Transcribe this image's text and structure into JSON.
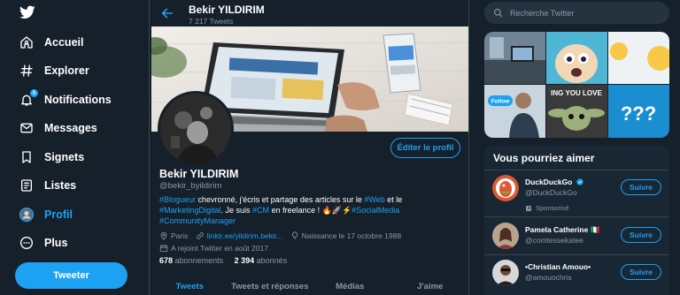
{
  "nav": {
    "items": [
      {
        "label": "Accueil",
        "icon": "home-icon"
      },
      {
        "label": "Explorer",
        "icon": "hashtag-icon"
      },
      {
        "label": "Notifications",
        "icon": "bell-icon",
        "badge": "5"
      },
      {
        "label": "Messages",
        "icon": "envelope-icon"
      },
      {
        "label": "Signets",
        "icon": "bookmark-icon"
      },
      {
        "label": "Listes",
        "icon": "list-icon"
      },
      {
        "label": "Profil",
        "icon": "profile-icon",
        "active": true
      },
      {
        "label": "Plus",
        "icon": "more-icon"
      }
    ],
    "tweet_button": "Tweeter"
  },
  "header": {
    "name": "Bekir YILDIRIM",
    "tweet_count": "7 217 Tweets"
  },
  "profile": {
    "edit_button": "Éditer le profil",
    "name": "Bekir YILDIRIM",
    "handle": "@bekir_byildirim",
    "bio": {
      "l1a": "#Blogueur",
      "l1b": " chevronné, j'écris et partage des articles sur le ",
      "l1c": "#Web",
      "l1d": " et le",
      "l2a": "#MarketingDigital",
      "l2b": ". Je suis ",
      "l2c": "#CM",
      "l2d": " en freelance ! 🔥🚀⚡",
      "l2e": "#SocialMedia",
      "l3a": "#CommunityManager"
    },
    "location": "Paris",
    "link": "linktr.ee/yildirim.bekir...",
    "birth": "Naissance le 17 octobre 1988",
    "joined": "A rejoint Twitter en août 2017",
    "following_count": "678",
    "following_label": "abonnements",
    "followers_count": "2 394",
    "followers_label": "abonnés"
  },
  "tabs": [
    "Tweets",
    "Tweets et réponses",
    "Médias",
    "J'aime"
  ],
  "search": {
    "placeholder": "Recherche Twitter"
  },
  "media_grid": {
    "follow_label": "Follow",
    "caption": "ING YOU LOVE"
  },
  "who_to_follow": {
    "title": "Vous pourriez aimer",
    "accounts": [
      {
        "name": "DuckDuckGo",
        "handle": "@DuckDuckGo",
        "button": "Suivre",
        "sponsored": "Sponsorisé"
      },
      {
        "name": "Pamela Catherine 🇮🇹",
        "handle": "@comtessekatee",
        "button": "Suivre"
      },
      {
        "name": "•Christian Amouo•",
        "handle": "@amouochris",
        "button": "Suivre"
      }
    ]
  },
  "colors": {
    "background": "#15202b",
    "accent": "#1da1f2",
    "secondary_text": "#8899a6",
    "border": "#38444d"
  }
}
